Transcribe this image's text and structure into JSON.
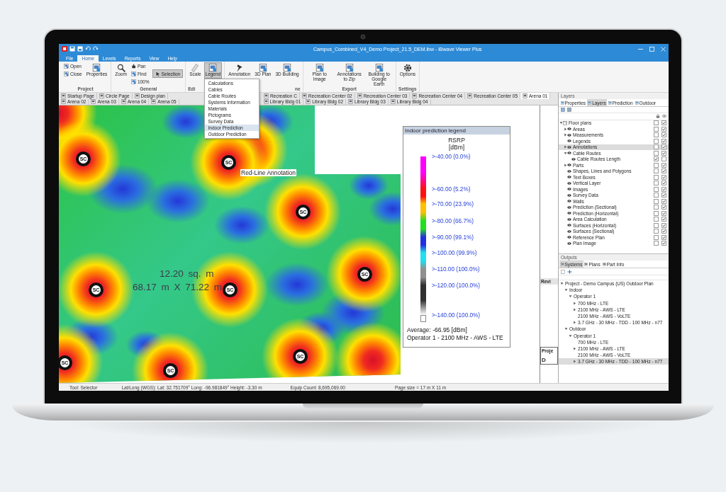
{
  "window": {
    "title": "Campus_Combined_V4_Demo Project_21.5_DEM.ibw - iBwave Viewer Plus"
  },
  "menu_tabs": [
    {
      "label": "File",
      "selected": false
    },
    {
      "label": "Home",
      "selected": true
    },
    {
      "label": "Levels",
      "selected": false
    },
    {
      "label": "Reports",
      "selected": false
    },
    {
      "label": "View",
      "selected": false
    },
    {
      "label": "Help",
      "selected": false
    }
  ],
  "ribbon": {
    "groups": [
      {
        "label": "Project",
        "buttons": [
          {
            "label": "Open",
            "kind": "small",
            "selected": false
          },
          {
            "label": "Close",
            "kind": "small",
            "selected": false
          },
          {
            "label": "Properties",
            "kind": "large",
            "selected": false
          }
        ]
      },
      {
        "label": "General",
        "buttons": [
          {
            "label": "Zoom",
            "kind": "large",
            "selected": false
          },
          {
            "label": "Pan",
            "kind": "small",
            "selected": false
          },
          {
            "label": "Find",
            "kind": "small",
            "selected": false
          },
          {
            "label": "100%",
            "kind": "small",
            "selected": false
          },
          {
            "label": "Selection",
            "kind": "wide",
            "selected": true
          }
        ]
      },
      {
        "label": "Edi",
        "buttons": [
          {
            "label": "Scale",
            "kind": "large",
            "selected": false
          },
          {
            "label": "Legend",
            "kind": "large",
            "selected": true
          }
        ]
      },
      {
        "label": "ne",
        "buttons": [
          {
            "label": "Annotation",
            "kind": "large",
            "selected": false
          },
          {
            "label": "3D Plan",
            "kind": "large",
            "selected": false
          },
          {
            "label": "3D Building",
            "kind": "large",
            "selected": false
          }
        ]
      },
      {
        "label": "Export",
        "buttons": [
          {
            "label": "Plan to Image",
            "kind": "large",
            "selected": false
          },
          {
            "label": "Annotations to Zip",
            "kind": "large",
            "selected": false
          },
          {
            "label": "Building to Google Earth",
            "kind": "large",
            "selected": false
          }
        ]
      },
      {
        "label": "Settings",
        "buttons": [
          {
            "label": "Options",
            "kind": "large",
            "selected": false
          }
        ]
      }
    ]
  },
  "legend_menu": {
    "items": [
      {
        "label": "Calculations",
        "selected": false
      },
      {
        "label": "Cables",
        "selected": false
      },
      {
        "label": "Cable Routes",
        "selected": false
      },
      {
        "label": "Systems Information",
        "selected": false
      },
      {
        "label": "Materials",
        "selected": false
      },
      {
        "label": "Pictograms",
        "selected": false
      },
      {
        "label": "Survey Data",
        "selected": false
      },
      {
        "label": "Indoor Prediction",
        "selected": true
      },
      {
        "label": "Outdoor Prediction",
        "selected": false
      }
    ]
  },
  "doc_tabs": [
    {
      "label": "Startup Page",
      "selected": false
    },
    {
      "label": "Circle Page",
      "selected": false
    },
    {
      "label": "Design plan",
      "selected": false
    },
    {
      "label": "Recreation C",
      "selected": false
    },
    {
      "label": "Recreation Center 02",
      "selected": false
    },
    {
      "label": "Recreation Center 03",
      "selected": false
    },
    {
      "label": "Recreation Center 04",
      "selected": false
    },
    {
      "label": "Recreation Center 05",
      "selected": false
    },
    {
      "label": "Arena 01",
      "selected": true
    },
    {
      "label": "Arena 02",
      "selected": false
    },
    {
      "label": "Arena 03",
      "selected": false
    },
    {
      "label": "Arena 04",
      "selected": false
    },
    {
      "label": "Arena 05",
      "selected": false
    },
    {
      "label": "Library Bldg 01",
      "selected": false
    },
    {
      "label": "Library Bldg 02",
      "selected": false
    },
    {
      "label": "Library Bldg 03",
      "selected": false
    },
    {
      "label": "Library Bldg 04",
      "selected": false
    }
  ],
  "map": {
    "markers": [
      {
        "label": "SC"
      },
      {
        "label": "SC"
      },
      {
        "label": "SC"
      },
      {
        "label": "SC"
      },
      {
        "label": "SC"
      },
      {
        "label": "SC"
      },
      {
        "label": "SC"
      },
      {
        "label": "SC"
      },
      {
        "label": "SC"
      }
    ],
    "annotation": {
      "label": "Red-Line Annotation"
    },
    "area": {
      "size": "12.20 sq. m",
      "dimensions": "68.17 m X 71.22 m"
    }
  },
  "legend": {
    "title": "Indoor prediction legend",
    "metric": "RSRP",
    "unit": "[dBm]",
    "entries": [
      {
        "label": ">-40.00 (0.0%)",
        "color": "#ff00ff"
      },
      {
        "label": ">-60.00 (5.2%)",
        "color": "#ff1010"
      },
      {
        "label": ">-70.00 (23.9%)",
        "color": "#ffc000"
      },
      {
        "label": ">-80.00 (66.7%)",
        "color": "#20e020"
      },
      {
        "label": ">-90.00 (99.1%)",
        "color": "#2030e0"
      },
      {
        "label": ">-100.00 (99.9%)",
        "color": "#20e0f0"
      },
      {
        "label": ">-110.00 (100.0%)",
        "color": "#909090"
      },
      {
        "label": ">-120.00 (100.0%)",
        "color": "#303030"
      },
      {
        "label": ">-140.00 (100.0%)",
        "color": "#ffffff"
      }
    ],
    "average": "Average: -66.95 [dBm]",
    "operator": "Operator 1 - 2100 MHz - AWS - LTE"
  },
  "side_strip": {
    "header": "Revi",
    "box_title": "Proje",
    "box_text": "D"
  },
  "layers": {
    "title": "Layers",
    "tabs": [
      {
        "label": "Properties",
        "selected": false
      },
      {
        "label": "Layers",
        "selected": true
      },
      {
        "label": "Prediction",
        "selected": false
      },
      {
        "label": "Outdoor",
        "selected": false
      }
    ],
    "tree": [
      {
        "label": "Floor plans",
        "expanded": true,
        "locked": false,
        "visible": true,
        "selected": false,
        "children": [
          {
            "label": "Areas",
            "expanded": false,
            "locked": false,
            "visible": true,
            "selected": false
          },
          {
            "label": "Measurements",
            "expanded": false,
            "locked": false,
            "visible": true,
            "selected": false
          },
          {
            "label": "Legends",
            "locked": false,
            "visible": true,
            "selected": false
          },
          {
            "label": "Annotations",
            "expanded": false,
            "locked": false,
            "visible": true,
            "selected": true
          },
          {
            "label": "Cable Routes",
            "expanded": true,
            "locked": false,
            "visible": true,
            "selected": false,
            "children": [
              {
                "label": "Cable Routes Length",
                "locked": true,
                "visible": false,
                "selected": false
              }
            ]
          },
          {
            "label": "Parts",
            "expanded": false,
            "locked": false,
            "visible": true,
            "selected": false
          },
          {
            "label": "Shapes, Lines and Polygons",
            "locked": false,
            "visible": true,
            "selected": false
          },
          {
            "label": "Text Boxes",
            "locked": false,
            "visible": true,
            "selected": false
          },
          {
            "label": "Vertical Layer",
            "locked": false,
            "visible": true,
            "selected": false
          },
          {
            "label": "Images",
            "locked": false,
            "visible": true,
            "selected": false
          },
          {
            "label": "Survey Data",
            "locked": false,
            "visible": true,
            "selected": false
          },
          {
            "label": "Walls",
            "locked": false,
            "visible": true,
            "selected": false
          },
          {
            "label": "Prediction (Sectional)",
            "locked": false,
            "visible": true,
            "selected": false
          },
          {
            "label": "Prediction (Horizontal)",
            "locked": false,
            "visible": true,
            "selected": false
          },
          {
            "label": "Area Calculation",
            "locked": false,
            "visible": true,
            "selected": false
          },
          {
            "label": "Surfaces (Horizontal)",
            "locked": false,
            "visible": true,
            "selected": false
          },
          {
            "label": "Surfaces (Sectional)",
            "locked": false,
            "visible": true,
            "selected": false
          },
          {
            "label": "Reference Plan",
            "locked": false,
            "visible": true,
            "selected": false
          },
          {
            "label": "Plan Image",
            "locked": false,
            "visible": true,
            "selected": false
          }
        ]
      }
    ]
  },
  "outputs": {
    "title": "Outputs",
    "tabs": [
      {
        "label": "Systems",
        "selected": true
      },
      {
        "label": "Plans",
        "selected": false
      },
      {
        "label": "Part Info",
        "selected": false
      }
    ],
    "tree": [
      {
        "label": "Project - Demo Campus (US) Outdoor Plan",
        "expanded": true,
        "selected": false,
        "children": [
          {
            "label": "Indoor",
            "expanded": true,
            "selected": false,
            "children": [
              {
                "label": "Operator 1",
                "expanded": true,
                "selected": false,
                "children": [
                  {
                    "label": "700 MHz - LTE",
                    "expanded": false,
                    "selected": false
                  },
                  {
                    "label": "2100 MHz - AWS - LTE",
                    "expanded": false,
                    "selected": false
                  },
                  {
                    "label": "2100 MHz - AWS - VoLTE",
                    "selected": false
                  },
                  {
                    "label": "3.7 GHz - 30 MHz - TDD - 100 MHz - n77",
                    "expanded": false,
                    "selected": false
                  }
                ]
              }
            ]
          },
          {
            "label": "Outdoor",
            "expanded": true,
            "selected": false,
            "children": [
              {
                "label": "Operator 1",
                "expanded": true,
                "selected": false,
                "children": [
                  {
                    "label": "700 MHz - LTE",
                    "selected": false
                  },
                  {
                    "label": "2100 MHz - AWS - LTE",
                    "expanded": false,
                    "selected": false
                  },
                  {
                    "label": "2100 MHz - AWS - VoLTE",
                    "selected": false
                  },
                  {
                    "label": "3.7 GHz - 30 MHz - TDD - 100 MHz - n77",
                    "expanded": false,
                    "selected": true
                  }
                ]
              }
            ]
          }
        ]
      }
    ]
  },
  "status_bar": [
    "Tool: Selector",
    "Lat/Long (WGS): Lat: 32.751709° Long: -96.981849° Height: -3.30 m",
    "Equip Count: 8,695,069.00",
    "Page size = 17 m X 11 m"
  ]
}
